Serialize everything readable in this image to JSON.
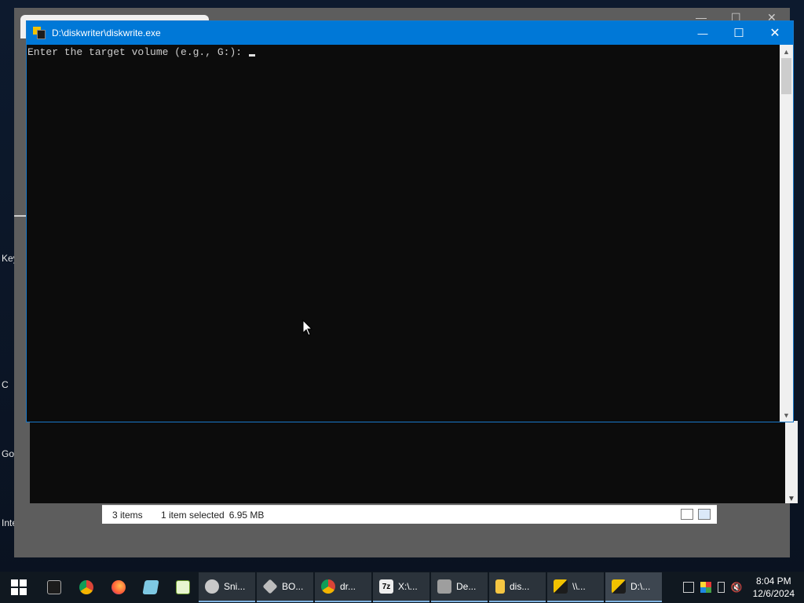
{
  "desktop": {
    "labels": [
      "Key",
      "C",
      "Go",
      "Inte"
    ]
  },
  "explorer": {
    "status": {
      "item_count": "3 items",
      "selection": "1 item selected",
      "size": "6.95 MB"
    }
  },
  "console": {
    "title": "D:\\diskwriter\\diskwrite.exe",
    "prompt": "Enter the target volume (e.g., G:): ",
    "controls": {
      "minimize": "—",
      "maximize": "☐",
      "close": "✕"
    }
  },
  "taskbar": {
    "pinned": [
      "cmd-icon",
      "chrome-icon",
      "firefox-icon",
      "notepad-icon",
      "spreadsheet-icon"
    ],
    "items": [
      {
        "label": "Sni...",
        "icon": "snipping-icon",
        "color": "#c9c9c9"
      },
      {
        "label": "BO...",
        "icon": "box-icon",
        "color": "#bdbdbd"
      },
      {
        "label": "dr...",
        "icon": "chrome-icon",
        "color": "#4caf50"
      },
      {
        "label": "X:\\...",
        "icon": "7zip-icon",
        "color": "#eeeeee"
      },
      {
        "label": "De...",
        "icon": "device-icon",
        "color": "#9e9e9e"
      },
      {
        "label": "dis...",
        "icon": "folder-icon",
        "color": "#f4c542"
      },
      {
        "label": "\\\\...",
        "icon": "console-icon",
        "color": "#f2c200"
      },
      {
        "label": "D:\\...",
        "icon": "console-icon",
        "color": "#f2c200"
      }
    ],
    "clock": {
      "time": "8:04 PM",
      "date": "12/6/2024"
    }
  }
}
